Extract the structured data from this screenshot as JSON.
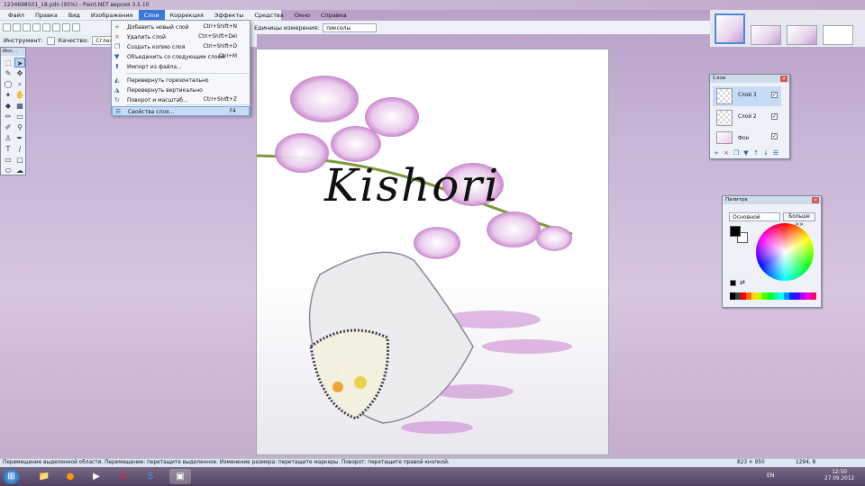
{
  "window": {
    "title": "1234698501_18.pdn (95%) - Paint.NET версия 3.5.10"
  },
  "menu": {
    "items": [
      "Файл",
      "Правка",
      "Вид",
      "Изображение",
      "Слои",
      "Коррекция",
      "Эффекты",
      "Средства",
      "Окно",
      "Справка"
    ],
    "active_index": 4
  },
  "toolbar2": {
    "tool_label": "Инструмент:",
    "quality_label": "Качество:",
    "quality_value": "Сглаживание"
  },
  "unitsbar": {
    "units_label": "Единицы измерения:",
    "units_value": "пикселы"
  },
  "layers_menu": {
    "items": [
      {
        "label": "Добавить новый слой",
        "shortcut": "Ctrl+Shift+N",
        "icon": "add-layer-icon"
      },
      {
        "label": "Удалить слой",
        "shortcut": "Ctrl+Shift+Del",
        "icon": "delete-layer-icon"
      },
      {
        "label": "Создать копию слоя",
        "shortcut": "Ctrl+Shift+D",
        "icon": "duplicate-layer-icon"
      },
      {
        "label": "Объединить со следующим слоем",
        "shortcut": "Ctrl+M",
        "icon": "merge-layer-icon"
      },
      {
        "label": "Импорт из файла...",
        "shortcut": "",
        "icon": "import-file-icon"
      },
      {
        "label": "Перевернуть горизонтально",
        "shortcut": "",
        "icon": "flip-horizontal-icon"
      },
      {
        "label": "Перевернуть вертикально",
        "shortcut": "",
        "icon": "flip-vertical-icon"
      },
      {
        "label": "Поворот и масштаб...",
        "shortcut": "Ctrl+Shift+Z",
        "icon": "rotate-zoom-icon"
      },
      {
        "label": "Свойства слоя...",
        "shortcut": "F4",
        "icon": "layer-properties-icon"
      }
    ],
    "highlight_index": 8
  },
  "tools_panel": {
    "title": "Инс..."
  },
  "layers_panel": {
    "title": "Слои",
    "layers": [
      {
        "name": "Слой 3",
        "visible": true,
        "selected": true
      },
      {
        "name": "Слой 2",
        "visible": true,
        "selected": false
      },
      {
        "name": "Фон",
        "visible": true,
        "selected": false
      }
    ]
  },
  "palette_panel": {
    "title": "Палитра",
    "mode": "Основной",
    "more_label": "Больше >>",
    "primary_color": "#000000",
    "secondary_color": "#ffffff"
  },
  "canvas": {
    "watermark": "Kishori"
  },
  "statusbar": {
    "hint": "Перемещение выделенной области. Перемещение: перетащите выделенное. Изменение размера: перетащите маркеры. Поворот: перетащите правой кнопкой.",
    "size": "823 × 950",
    "cursor": "1294, 8"
  },
  "taskbar": {
    "lang": "EN",
    "time": "12:50",
    "date": "27.09.2012"
  }
}
